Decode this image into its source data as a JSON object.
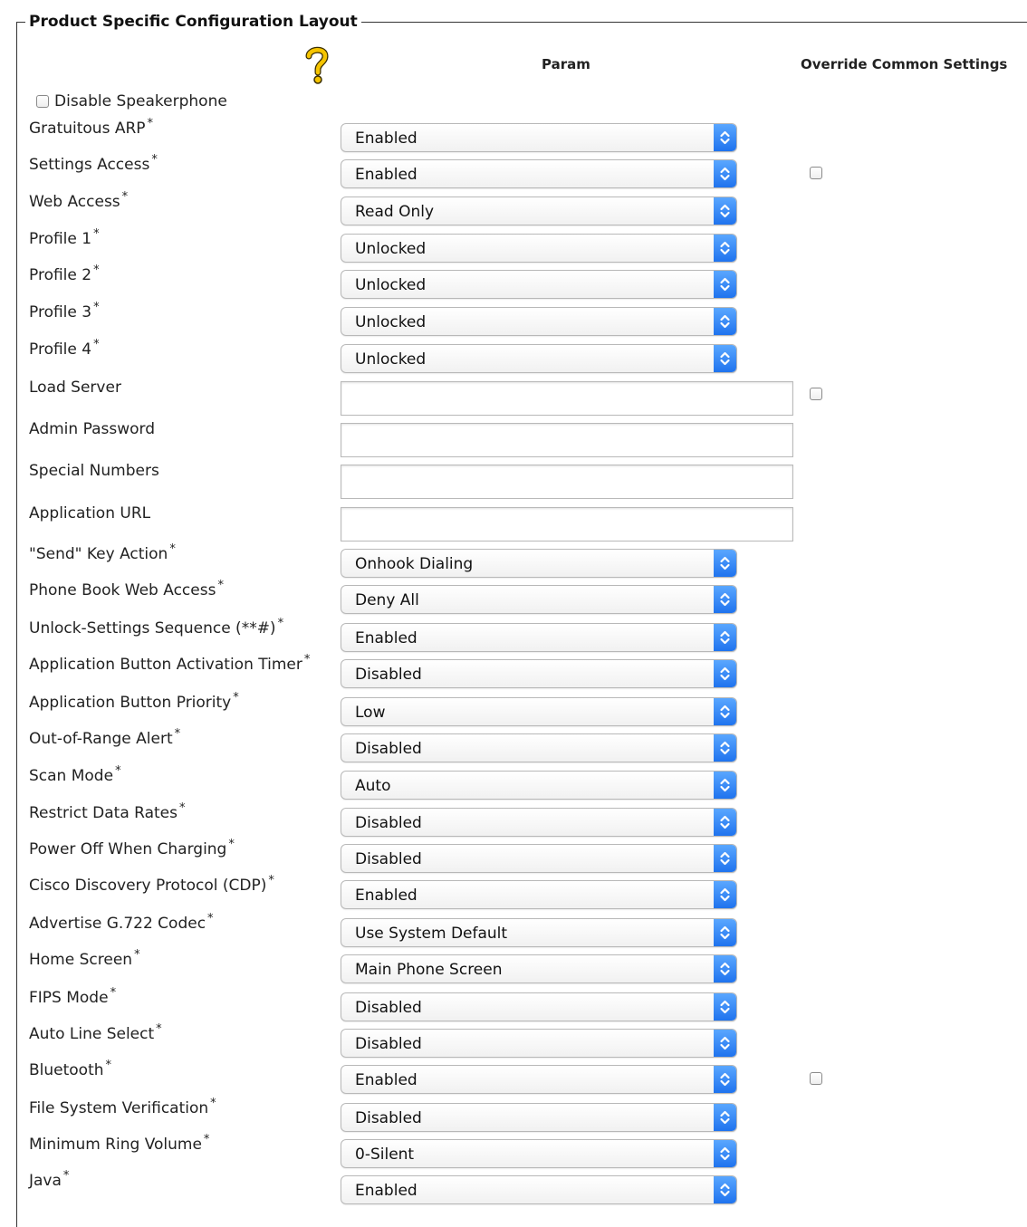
{
  "panel": {
    "title": "Product Specific Configuration Layout",
    "param_header": "Param",
    "override_header": "Override Common Settings"
  },
  "speakerphone": {
    "label": "Disable Speakerphone",
    "checked": false
  },
  "rows": [
    {
      "label": "Gratuitous ARP",
      "required": "*",
      "value": "Enabled"
    },
    {
      "label": "Settings Access",
      "required": "*",
      "value": "Enabled"
    },
    {
      "label": "Web Access",
      "required": "*",
      "value": "Read Only"
    },
    {
      "label": "Profile 1",
      "required": "*",
      "value": "Unlocked"
    },
    {
      "label": "Profile 2",
      "required": "*",
      "value": "Unlocked"
    },
    {
      "label": "Profile 3",
      "required": "*",
      "value": "Unlocked"
    },
    {
      "label": "Profile 4",
      "required": "*",
      "value": "Unlocked"
    },
    {
      "label": "Load Server",
      "required": "",
      "value": ""
    },
    {
      "label": "Admin Password",
      "required": "",
      "value": ""
    },
    {
      "label": "Special Numbers",
      "required": "",
      "value": ""
    },
    {
      "label": "Application URL",
      "required": "",
      "value": ""
    },
    {
      "label": "\"Send\" Key Action",
      "required": "*",
      "value": "Onhook Dialing"
    },
    {
      "label": "Phone Book Web Access",
      "required": "*",
      "value": "Deny All"
    },
    {
      "label": "Unlock-Settings Sequence (**#)",
      "required": "*",
      "value": "Enabled"
    },
    {
      "label": "Application Button Activation Timer",
      "required": "*",
      "value": "Disabled"
    },
    {
      "label": "Application Button Priority",
      "required": "*",
      "value": "Low"
    },
    {
      "label": "Out-of-Range Alert",
      "required": "*",
      "value": "Disabled"
    },
    {
      "label": "Scan Mode",
      "required": "*",
      "value": "Auto"
    },
    {
      "label": "Restrict Data Rates",
      "required": "*",
      "value": "Disabled"
    },
    {
      "label": "Power Off When Charging",
      "required": "*",
      "value": "Disabled"
    },
    {
      "label": "Cisco Discovery Protocol (CDP)",
      "required": "*",
      "value": "Enabled"
    },
    {
      "label": "Advertise G.722 Codec",
      "required": "*",
      "value": "Use System Default"
    },
    {
      "label": "Home Screen",
      "required": "*",
      "value": "Main Phone Screen"
    },
    {
      "label": "FIPS Mode",
      "required": "*",
      "value": "Disabled"
    },
    {
      "label": "Auto Line Select",
      "required": "*",
      "value": "Disabled"
    },
    {
      "label": "Bluetooth",
      "required": "*",
      "value": "Enabled"
    },
    {
      "label": "File System Verification",
      "required": "*",
      "value": "Disabled"
    },
    {
      "label": "Minimum Ring Volume",
      "required": "*",
      "value": "0-Silent"
    },
    {
      "label": "Java",
      "required": "*",
      "value": "Enabled"
    }
  ],
  "colors": {
    "dropdown_arrow_top": "#5aa7ff",
    "dropdown_arrow_bottom": "#1f73ee",
    "help_icon": "#f5c400"
  },
  "icons": {
    "help": "question-mark-help-icon",
    "dropdown": "chevron-up-down-icon"
  }
}
